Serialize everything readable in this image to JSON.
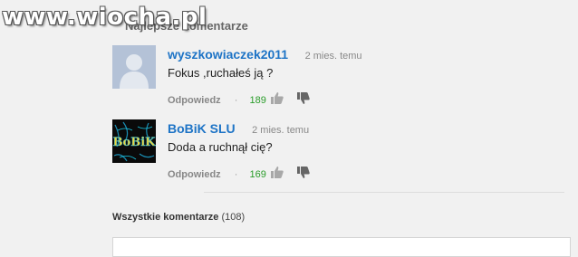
{
  "watermark": "www.wiocha.pl",
  "header": {
    "title": "Najlepsze komentarze"
  },
  "comments": [
    {
      "author": "wyszkowiaczek2011",
      "time": "2 mies. temu",
      "text": "Fokus ,ruchałeś ją ?",
      "reply_label": "Odpowiedz",
      "separator": "·",
      "likes": "189",
      "avatar_icon": "default-user-avatar"
    },
    {
      "author": "BoBiK SLU",
      "time": "2 mies. temu",
      "text": "Doda a ruchnął cię?",
      "reply_label": "Odpowiedz",
      "separator": "·",
      "likes": "169",
      "avatar_text": "BoBiK"
    }
  ],
  "all_comments": {
    "label": "Wszystkie komentarze",
    "count": "(108)"
  },
  "colors": {
    "author": "#1e74c6",
    "likes": "#2a9c2a",
    "muted": "#888888"
  }
}
